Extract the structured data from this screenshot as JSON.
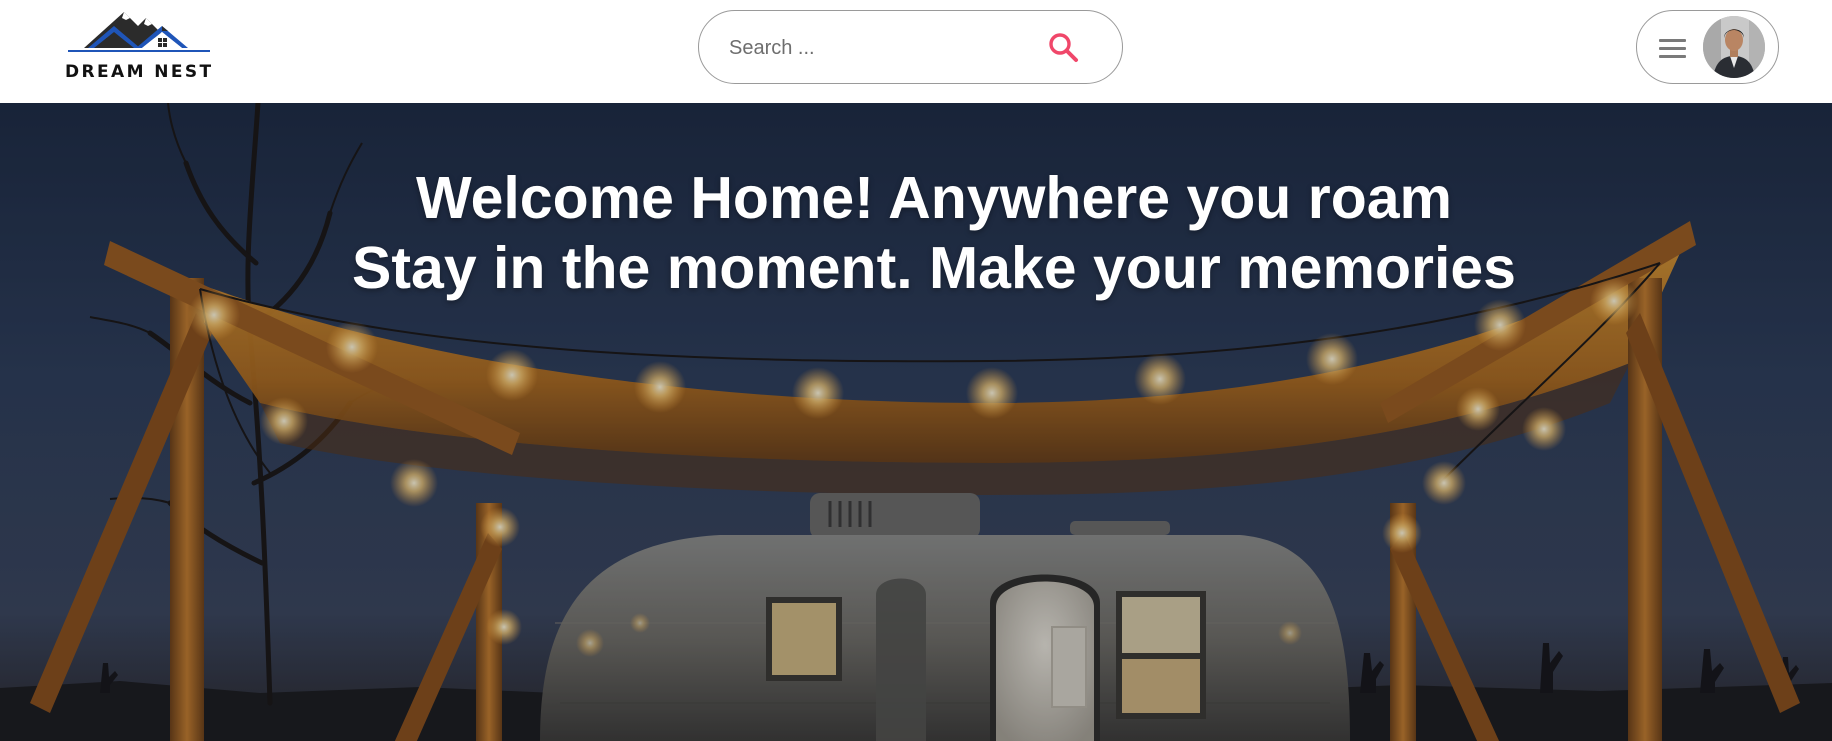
{
  "brand": {
    "name": "DREAM NEST",
    "logo_icon": "house-mountain-logo",
    "colors": {
      "mountain": "#2b2b2b",
      "house_blue": "#1f55b8"
    }
  },
  "search": {
    "placeholder": "Search ...",
    "value": "",
    "icon": "search-icon",
    "icon_color": "#f0476a"
  },
  "user_menu": {
    "menu_icon": "hamburger-menu-icon",
    "avatar_icon": "user-avatar"
  },
  "hero": {
    "title_line1": "Welcome Home! Anywhere you roam",
    "title_line2": "Stay in the moment. Make your memories",
    "background": "camper-trailer-under-string-lights-at-dusk"
  }
}
